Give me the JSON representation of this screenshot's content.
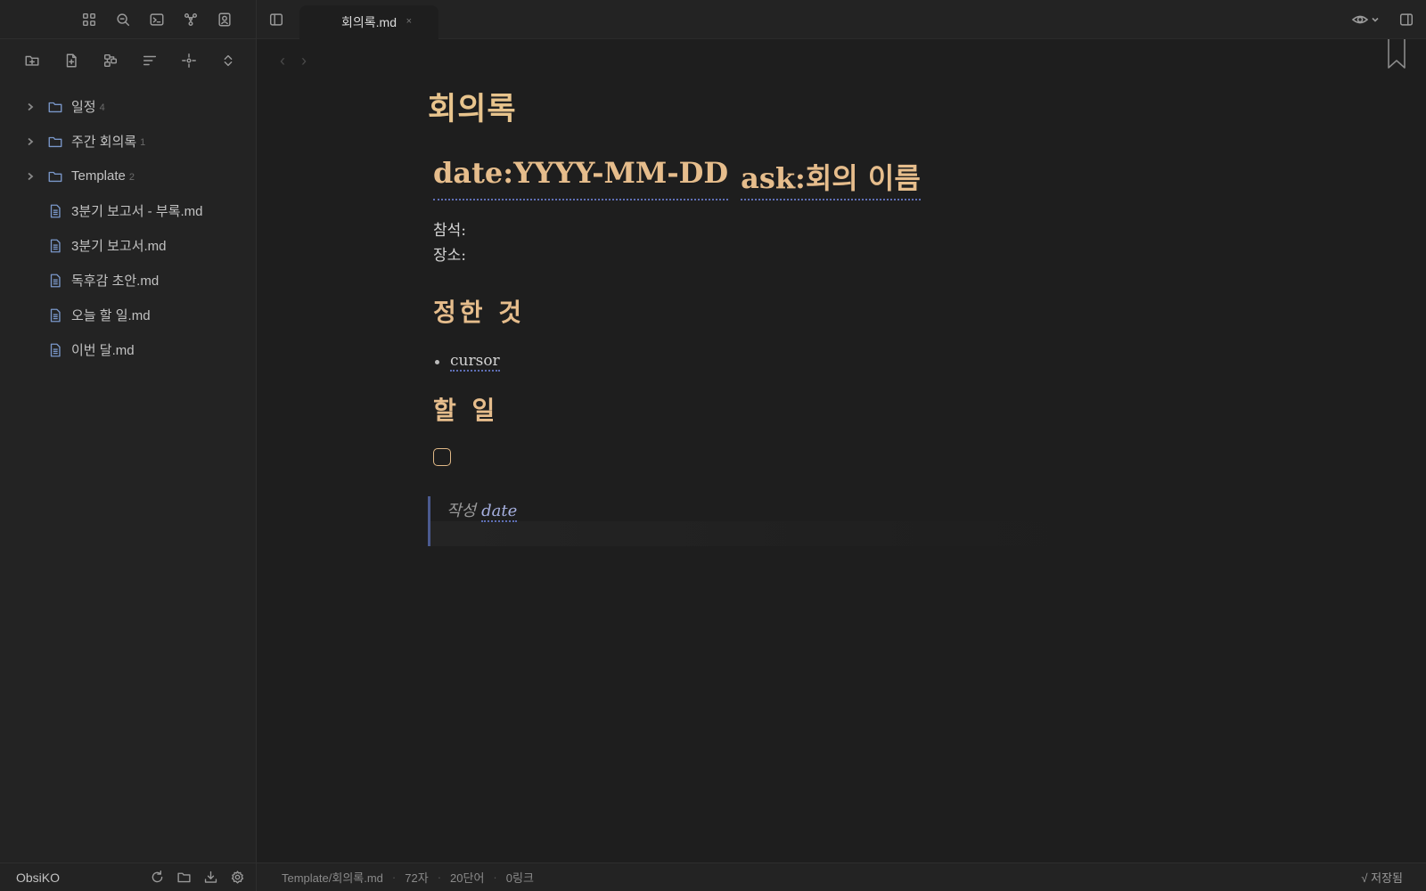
{
  "sidebar": {
    "ribbon_icons": [
      "layout-grid-icon",
      "search-icon",
      "terminal-icon",
      "graph-icon",
      "contact-icon"
    ],
    "nav_icons": [
      "new-folder-icon",
      "new-note-icon",
      "canvas-icon",
      "sort-icon",
      "locate-icon",
      "collapse-expand-icon"
    ],
    "items": [
      {
        "type": "folder",
        "label": "일정",
        "count": "4"
      },
      {
        "type": "folder",
        "label": "주간 회의록",
        "count": "1"
      },
      {
        "type": "folder",
        "label": "Template",
        "count": "2"
      },
      {
        "type": "file",
        "label": "3분기 보고서 - 부록.md"
      },
      {
        "type": "file",
        "label": "3분기 보고서.md"
      },
      {
        "type": "file",
        "label": "독후감 초안.md"
      },
      {
        "type": "file",
        "label": "오늘 할 일.md"
      },
      {
        "type": "file",
        "label": "이번 달.md"
      }
    ],
    "vault_name": "ObsiKO",
    "footer_icons": [
      "sync-icon",
      "folder-icon",
      "download-icon",
      "settings-icon"
    ]
  },
  "tab": {
    "title": "회의록.md",
    "close": "×"
  },
  "nav": {
    "back": "‹",
    "forward": "›"
  },
  "document": {
    "title": "회의록",
    "heading_parts": [
      "date:YYYY-MM-DD",
      "ask:회의 이름"
    ],
    "props": [
      "참석:",
      "장소:"
    ],
    "section1": "정한 것",
    "bullet": "cursor",
    "section2": "할 일",
    "quote_prefix": "작성",
    "quote_link": "date"
  },
  "status": {
    "path": "Template/회의록.md",
    "chars": "72자",
    "words": "20단어",
    "links": "0링크",
    "saved": "√ 저장됨"
  },
  "colors": {
    "heading": "#e6bd8c",
    "link_underline": "#5f6fb5",
    "folder_icon": "#7a97c9"
  }
}
